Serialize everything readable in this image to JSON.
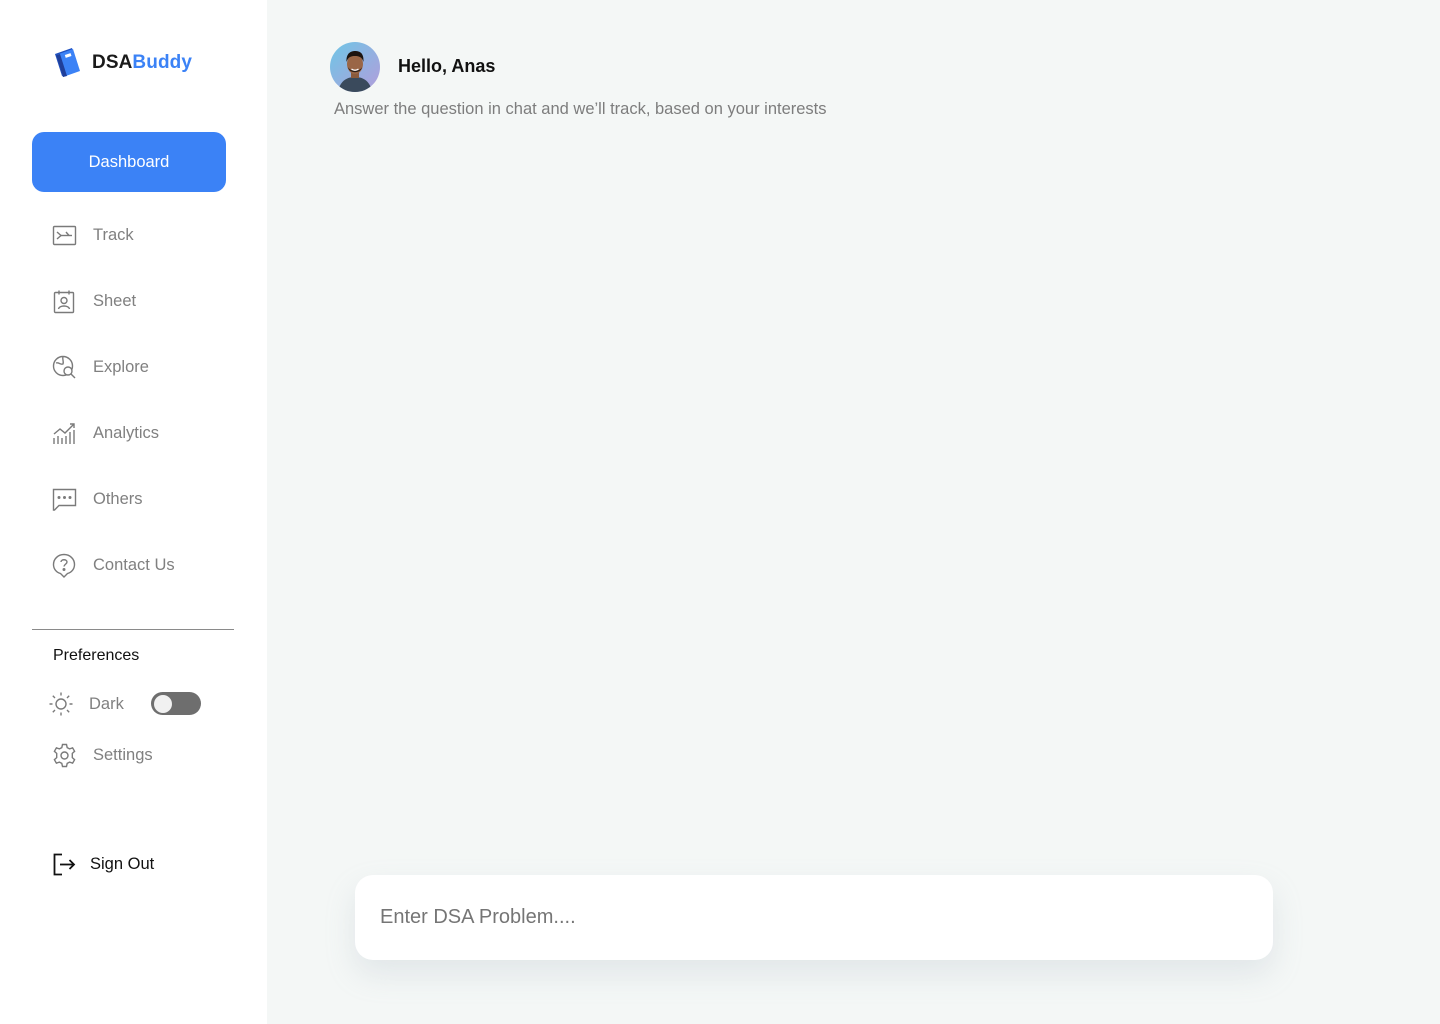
{
  "brand": {
    "name_part1": "DSA",
    "name_part2": "Buddy",
    "accent": "#3b82f6"
  },
  "sidebar": {
    "active": {
      "label": "Dashboard"
    },
    "items": [
      {
        "label": "Track",
        "icon": "track-icon"
      },
      {
        "label": "Sheet",
        "icon": "sheet-icon"
      },
      {
        "label": "Explore",
        "icon": "explore-icon"
      },
      {
        "label": "Analytics",
        "icon": "analytics-icon"
      },
      {
        "label": "Others",
        "icon": "chat-dots-icon"
      },
      {
        "label": "Contact Us",
        "icon": "help-icon"
      }
    ],
    "preferences": {
      "title": "Preferences",
      "dark_label": "Dark",
      "dark_enabled": false,
      "settings_label": "Settings"
    },
    "signout_label": "Sign Out"
  },
  "header": {
    "greeting": "Hello, Anas",
    "subtitle": "Answer the question in chat and we’ll track, based on your interests"
  },
  "chat": {
    "placeholder": "Enter DSA Problem...."
  }
}
